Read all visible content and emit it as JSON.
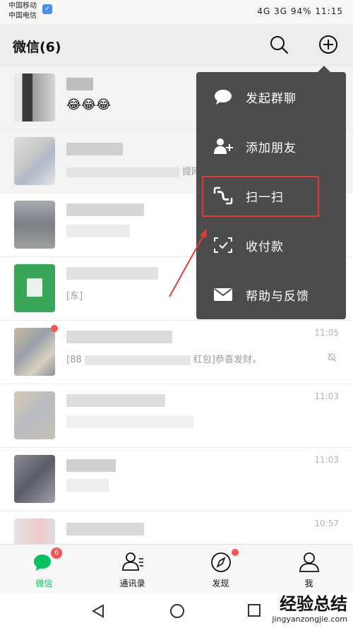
{
  "status_bar": {
    "carrier1": "中国移动",
    "carrier2": "中国电信",
    "battery": "94%",
    "time": "11:15",
    "signal_text": "4G 3G"
  },
  "header": {
    "title": "微信(6)"
  },
  "chats": [
    {
      "preview": "😂😂😂",
      "time": ""
    },
    {
      "preview": "",
      "time": "",
      "snippet": "提网"
    },
    {
      "preview": "",
      "time": ""
    },
    {
      "preview": "",
      "time": "",
      "snippet": "[东]"
    },
    {
      "preview": "[88",
      "tail": "红包]恭喜发财，",
      "time": "11:05"
    },
    {
      "preview": "",
      "time": "11:03"
    },
    {
      "preview": "",
      "time": "11:03"
    },
    {
      "preview": "",
      "time": "10:57"
    }
  ],
  "menu": {
    "items": [
      {
        "label": "发起群聊",
        "icon": "chat-bubble-icon"
      },
      {
        "label": "添加朋友",
        "icon": "add-friend-icon"
      },
      {
        "label": "扫一扫",
        "icon": "scan-icon"
      },
      {
        "label": "收付款",
        "icon": "payment-icon"
      },
      {
        "label": "帮助与反馈",
        "icon": "mail-icon"
      }
    ]
  },
  "tabs": [
    {
      "label": "微信",
      "badge": "6",
      "active": true
    },
    {
      "label": "通讯录",
      "badge": "",
      "active": false
    },
    {
      "label": "发现",
      "badge": "",
      "active": false
    },
    {
      "label": "我",
      "badge": "",
      "active": false
    }
  ],
  "watermark": {
    "line1": "经验总结",
    "line2": "jingyanzongjie.com"
  },
  "colors": {
    "accent": "#07c160",
    "highlight": "#e03a3a",
    "menu_bg": "#4c4c4c"
  }
}
